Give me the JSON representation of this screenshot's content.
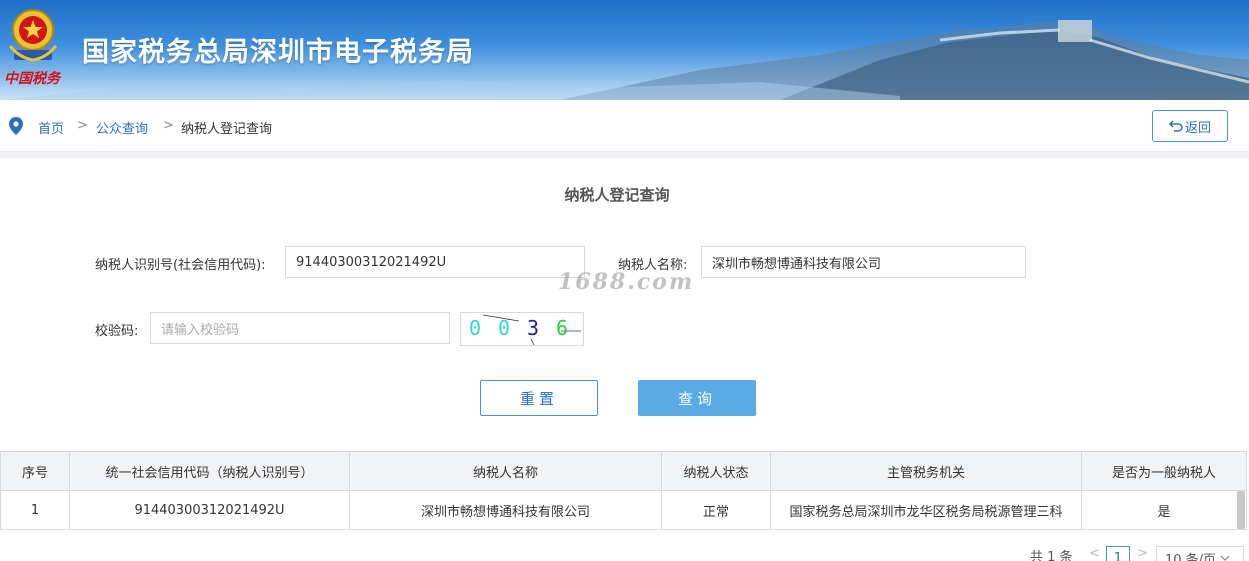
{
  "header": {
    "title": "国家税务总局深圳市电子税务局",
    "brand_script": "中国税务"
  },
  "breadcrumb": {
    "home": "首页",
    "sep1": ">",
    "public_query": "公众查询",
    "sep2": ">",
    "current": "纳税人登记查询"
  },
  "back_button": {
    "label": "返回",
    "icon": "undo-arrow-icon"
  },
  "form": {
    "title": "纳税人登记查询",
    "taxpayer_id_label": "纳税人识别号(社会信用代码):",
    "taxpayer_id_value": "91440300312021492U",
    "taxpayer_name_label": "纳税人名称:",
    "taxpayer_name_value": "深圳市畅想博通科技有限公司",
    "captcha_label": "校验码:",
    "captcha_placeholder": "请输入校验码",
    "captcha_chars": [
      {
        "c": "0",
        "color": "#2fd3e8"
      },
      {
        "c": "0",
        "color": "#2fd3e8"
      },
      {
        "c": "3",
        "color": "#1a1aa8"
      },
      {
        "c": "6",
        "color": "#2ecc40"
      }
    ],
    "watermark": "1688.com",
    "reset_label": "重置",
    "query_label": "查询"
  },
  "table": {
    "headers": [
      "序号",
      "统一社会信用代码（纳税人识别号）",
      "纳税人名称",
      "纳税人状态",
      "主管税务机关",
      "是否为一般纳税人"
    ],
    "rows": [
      [
        "1",
        "91440300312021492U",
        "深圳市畅想博通科技有限公司",
        "正常",
        "国家税务总局深圳市龙华区税务局税源管理三科",
        "是"
      ]
    ]
  },
  "pagination": {
    "total": "共 1 条",
    "prev": "<",
    "page": "1",
    "next": ">",
    "page_size": "10 条/页"
  },
  "colors": {
    "accent": "#2a6fc4",
    "query_button": "#5aaae8",
    "banner": "#1f6fc9"
  }
}
